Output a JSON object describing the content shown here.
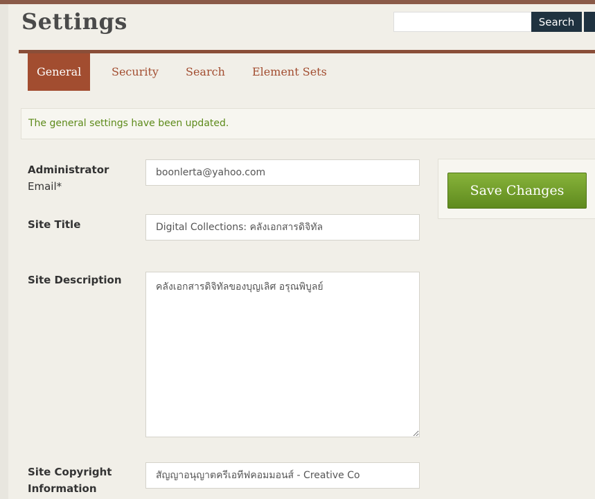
{
  "header": {
    "title": "Settings",
    "search": {
      "value": "",
      "placeholder": "",
      "button_label": "Search"
    }
  },
  "tabs": [
    {
      "label": "General",
      "active": true
    },
    {
      "label": "Security",
      "active": false
    },
    {
      "label": "Search",
      "active": false
    },
    {
      "label": "Element Sets",
      "active": false
    }
  ],
  "flash": {
    "message": "The general settings have been updated."
  },
  "form": {
    "admin_email": {
      "label_line1": "Administrator",
      "label_line2": "Email*",
      "value": "boonlerta@yahoo.com"
    },
    "site_title": {
      "label": "Site Title",
      "value": "Digital Collections: คลังเอกสารดิจิทัล"
    },
    "site_description": {
      "label": "Site Description",
      "value": "คลังเอกสารดิจิทัลของบุญเลิศ อรุณพิบูลย์"
    },
    "site_copyright": {
      "label_line1": "Site Copyright",
      "label_line2": "Information",
      "value": "สัญญาอนุญาตครีเอทีฟคอมมอนส์ - Creative Co"
    }
  },
  "actions": {
    "save_label": "Save Changes"
  },
  "colors": {
    "brand": "#a24d30",
    "header_border": "#8a5a48",
    "search_button": "#1f3240",
    "success_text": "#5d8a1a",
    "save_button": "#6e9a28"
  }
}
